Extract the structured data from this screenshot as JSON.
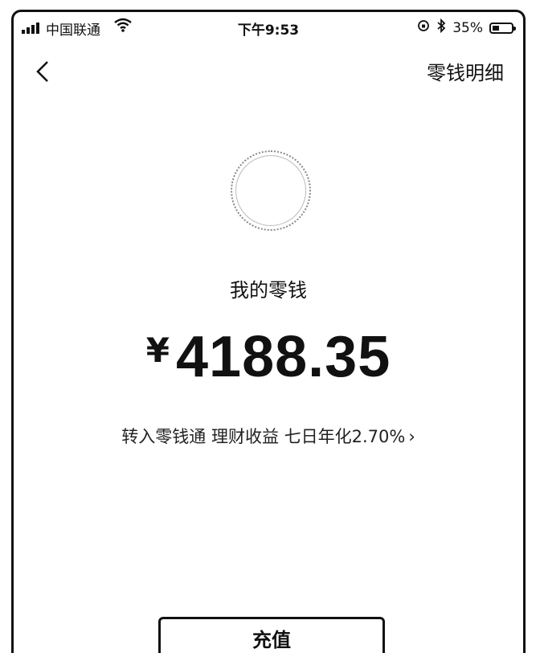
{
  "status_bar": {
    "carrier": "中国联通",
    "time": "下午9:53",
    "battery": "35%",
    "battery_level": 0.35
  },
  "nav": {
    "right_label": "零钱明细"
  },
  "wallet": {
    "label": "我的零钱",
    "currency_symbol": "¥",
    "amount": "4188.35",
    "promo_text": "转入零钱通 理财收益 七日年化2.70%",
    "promo_chevron": "›"
  },
  "actions": {
    "recharge_label": "充值"
  },
  "icons": {
    "back": "chevron-left-icon",
    "wifi": "wifi-icon",
    "bluetooth": "bluetooth-icon",
    "lock": "orientation-lock-icon"
  }
}
